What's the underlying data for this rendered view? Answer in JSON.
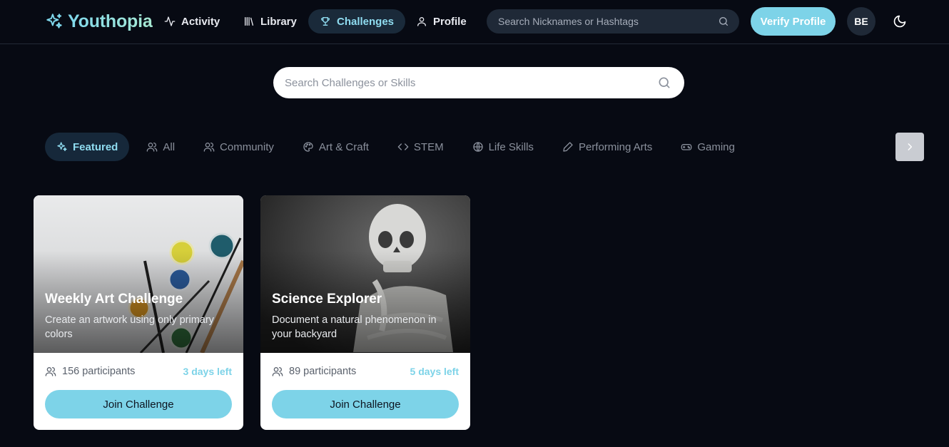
{
  "brand": {
    "name": "Youthopia",
    "icon": "sparkles-icon"
  },
  "nav": [
    {
      "label": "Activity",
      "icon": "activity-icon",
      "active": false
    },
    {
      "label": "Library",
      "icon": "library-icon",
      "active": false
    },
    {
      "label": "Challenges",
      "icon": "trophy-icon",
      "active": true
    },
    {
      "label": "Profile",
      "icon": "user-icon",
      "active": false
    }
  ],
  "top_search": {
    "placeholder": "Search Nicknames or Hashtags",
    "icon": "search-icon"
  },
  "verify_button": {
    "label": "Verify Profile"
  },
  "avatar": {
    "initials": "BE"
  },
  "theme_toggle": {
    "icon": "moon-icon"
  },
  "main_search": {
    "placeholder": "Search Challenges or Skills",
    "icon": "search-icon"
  },
  "categories": [
    {
      "label": "Featured",
      "icon": "sparkles-icon",
      "active": true
    },
    {
      "label": "All",
      "icon": "users-icon",
      "active": false
    },
    {
      "label": "Community",
      "icon": "users-icon",
      "active": false
    },
    {
      "label": "Art & Craft",
      "icon": "palette-icon",
      "active": false
    },
    {
      "label": "STEM",
      "icon": "code-icon",
      "active": false
    },
    {
      "label": "Life Skills",
      "icon": "globe-icon",
      "active": false
    },
    {
      "label": "Performing Arts",
      "icon": "pen-icon",
      "active": false
    },
    {
      "label": "Gaming",
      "icon": "gamepad-icon",
      "active": false
    }
  ],
  "category_next": {
    "icon": "chevron-right-icon"
  },
  "cards": [
    {
      "title": "Weekly Art Challenge",
      "description": "Create an artwork using only primary colors",
      "participants": "156 participants",
      "days_left": "3 days left",
      "button": "Join Challenge",
      "image": "paint-palette-photo"
    },
    {
      "title": "Science Explorer",
      "description": "Document a natural phenomenon in your backyard",
      "participants": "89 participants",
      "days_left": "5 days left",
      "button": "Join Challenge",
      "image": "skeleton-photo"
    }
  ],
  "colors": {
    "background": "#070a13",
    "accent": "#7dd3e8",
    "active_tab_bg": "#16283a",
    "muted": "#8a909c"
  }
}
